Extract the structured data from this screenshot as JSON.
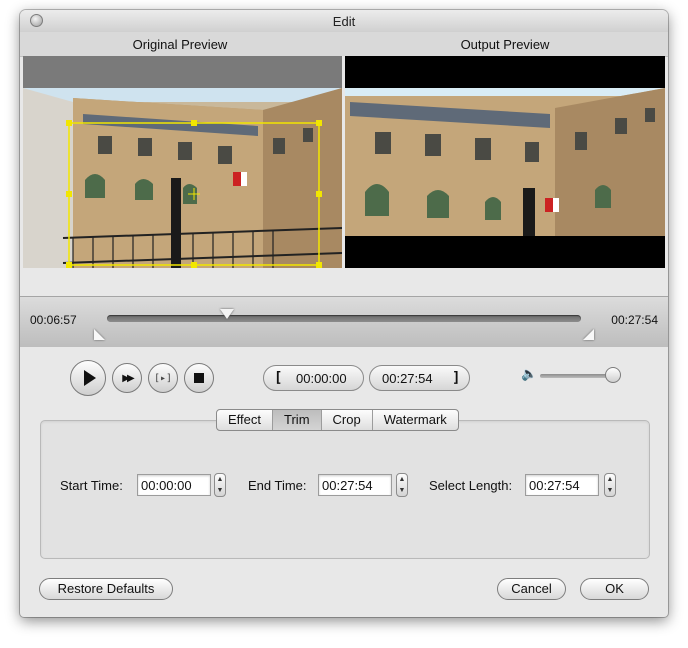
{
  "window": {
    "title": "Edit"
  },
  "preview": {
    "original_label": "Original Preview",
    "output_label": "Output Preview"
  },
  "timeline": {
    "current_time": "00:06:57",
    "end_time": "00:27:54",
    "playhead_fraction": 0.25
  },
  "playback": {
    "start_mark": "00:00:00",
    "end_mark": "00:27:54",
    "volume_level": 0.85
  },
  "tabs": [
    {
      "label": "Effect",
      "active": false
    },
    {
      "label": "Trim",
      "active": true
    },
    {
      "label": "Crop",
      "active": false
    },
    {
      "label": "Watermark",
      "active": false
    }
  ],
  "trim": {
    "start_label": "Start Time:",
    "start_value": "00:00:00",
    "end_label": "End Time:",
    "end_value": "00:27:54",
    "length_label": "Select Length:",
    "length_value": "00:27:54"
  },
  "buttons": {
    "restore": "Restore Defaults",
    "cancel": "Cancel",
    "ok": "OK"
  }
}
